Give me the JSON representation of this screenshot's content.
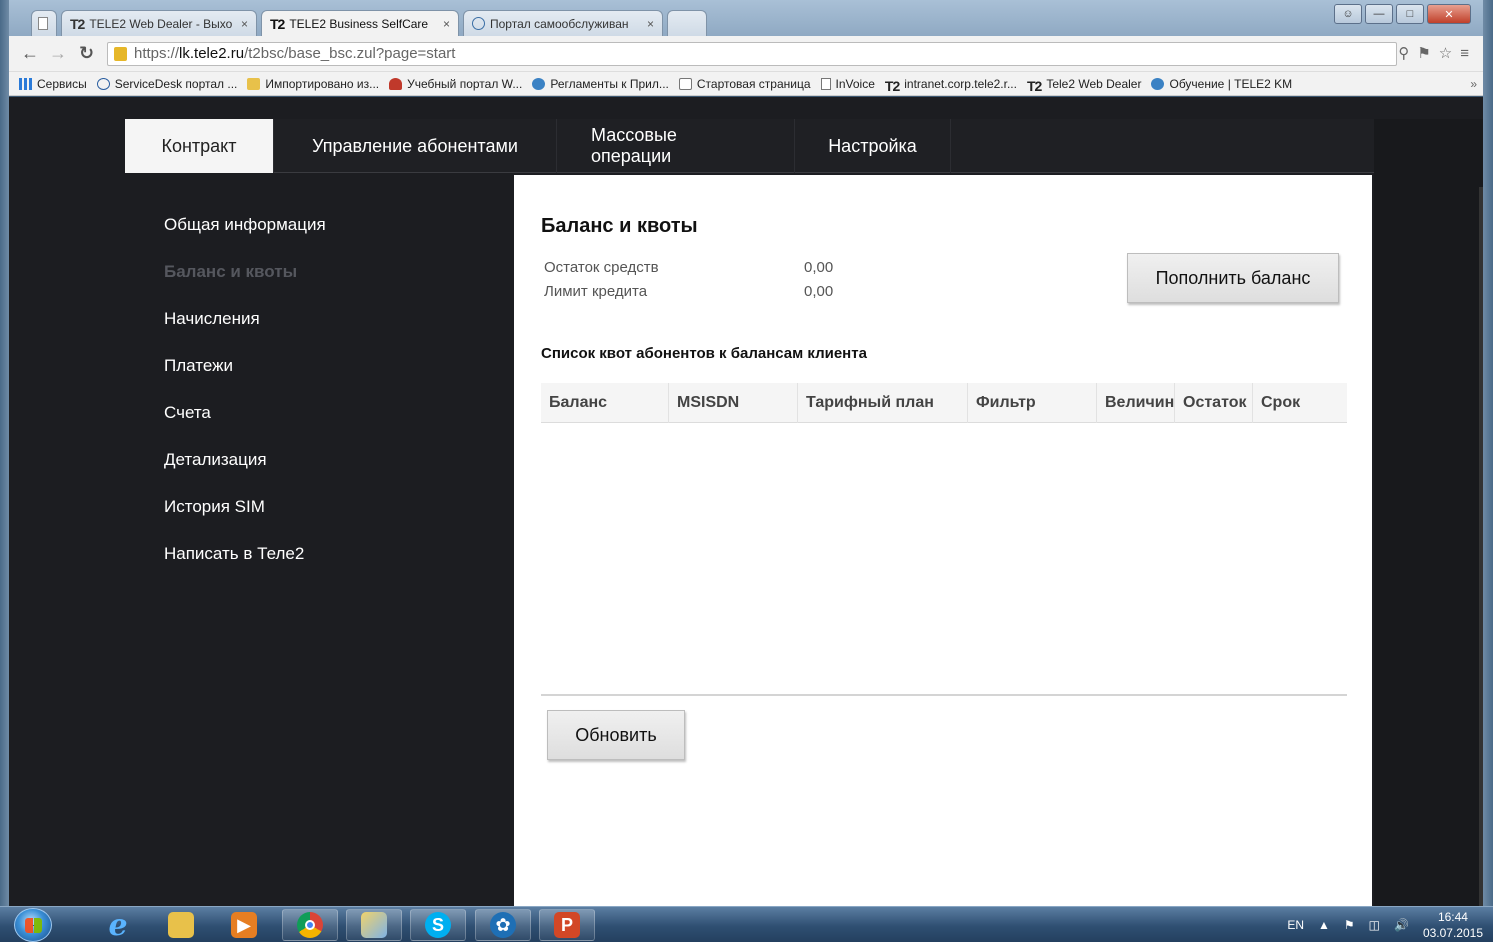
{
  "browser": {
    "tabs": [
      {
        "label": "TELE2 Web Dealer - Выхо",
        "icon": "tele2-icon",
        "active": false
      },
      {
        "label": "TELE2 Business SelfCare",
        "icon": "tele2-icon",
        "active": true
      },
      {
        "label": "Портал самообслуживан",
        "icon": "globe-icon",
        "active": false
      }
    ],
    "tab_logo": "T2",
    "tab_close": "×",
    "url_scheme": "https://",
    "url_host": "lk.tele2.ru",
    "url_path": "/t2bsc/base_bsc.zul?page=start",
    "bookmarks": [
      {
        "label": "Сервисы",
        "icon": "apps-grid-icon"
      },
      {
        "label": "ServiceDesk портал ...",
        "icon": "globe-icon"
      },
      {
        "label": "Импортировано из...",
        "icon": "folder-icon"
      },
      {
        "label": "Учебный портал W...",
        "icon": "graduation-cap-icon"
      },
      {
        "label": "Регламенты к Прил...",
        "icon": "ie-icon"
      },
      {
        "label": "Стартовая страница",
        "icon": "folder-icon"
      },
      {
        "label": "InVoice",
        "icon": "page-icon"
      },
      {
        "label": "intranet.corp.tele2.r...",
        "icon": "tele2-icon"
      },
      {
        "label": "Tele2 Web Dealer",
        "icon": "tele2-icon"
      },
      {
        "label": "Обучение | TELE2 KM",
        "icon": "ie-icon"
      }
    ],
    "bookmarks_more": "»"
  },
  "topnav": {
    "items": [
      {
        "label": "Контракт",
        "active": true
      },
      {
        "label": "Управление абонентами",
        "active": false
      },
      {
        "label": "Массовые операции",
        "active": false
      },
      {
        "label": "Настройка",
        "active": false
      }
    ]
  },
  "sidebar": {
    "items": [
      {
        "label": "Общая информация",
        "active": false
      },
      {
        "label": "Баланс и квоты",
        "active": true
      },
      {
        "label": "Начисления",
        "active": false
      },
      {
        "label": "Платежи",
        "active": false
      },
      {
        "label": "Счета",
        "active": false
      },
      {
        "label": "Детализация",
        "active": false
      },
      {
        "label": "История SIM",
        "active": false
      },
      {
        "label": "Написать в Теле2",
        "active": false
      }
    ]
  },
  "main": {
    "title": "Баланс и квоты",
    "balance_label": "Остаток средств",
    "balance_value": "0,00",
    "credit_label": "Лимит кредита",
    "credit_value": "0,00",
    "topup_button": "Пополнить баланс",
    "list_title": "Список квот абонентов к балансам клиента",
    "columns": [
      "Баланс",
      "MSISDN",
      "Тарифный план",
      "Фильтр",
      "Величин",
      "Остаток",
      "Срок"
    ],
    "refresh_button": "Обновить"
  },
  "taskbar": {
    "lang": "EN",
    "time": "16:44",
    "date": "03.07.2015"
  },
  "colors": {
    "app_bg": "#1c1d21",
    "content_bg": "#ffffff",
    "active_tab_bg": "#f5f5f5",
    "sidebar_active_text": "#55575e"
  }
}
